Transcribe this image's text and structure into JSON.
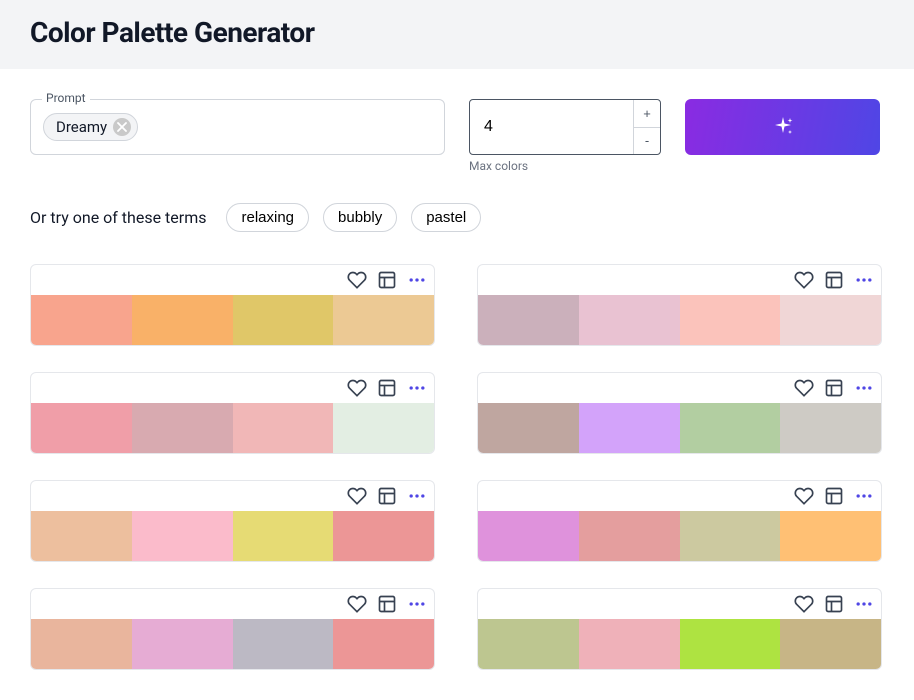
{
  "header": {
    "title": "Color Palette Generator"
  },
  "prompt": {
    "label": "Prompt",
    "tags": [
      "Dreamy"
    ]
  },
  "maxColors": {
    "value": "4",
    "label": "Max colors"
  },
  "suggest": {
    "intro": "Or try one of these terms",
    "items": [
      "relaxing",
      "bubbly",
      "pastel"
    ]
  },
  "palettes": [
    {
      "colors": [
        "#f8a48d",
        "#f9b168",
        "#e0c768",
        "#ecc994"
      ]
    },
    {
      "colors": [
        "#cbb0bb",
        "#e9c2d2",
        "#fbc3bb",
        "#f0d6d6"
      ]
    },
    {
      "colors": [
        "#f09ea8",
        "#d8aab0",
        "#f1b7b7",
        "#e3eee3"
      ]
    },
    {
      "colors": [
        "#bfa6a0",
        "#d3a3fa",
        "#b2cea1",
        "#cecbc5"
      ]
    },
    {
      "colors": [
        "#edbf9e",
        "#fbbbcb",
        "#e6db74",
        "#ec9696"
      ]
    },
    {
      "colors": [
        "#df92dc",
        "#e49e9e",
        "#ccc9a0",
        "#ffc074"
      ]
    },
    {
      "colors": [
        "#e9b59d",
        "#e6acd4",
        "#bcb9c4",
        "#ec9696"
      ]
    },
    {
      "colors": [
        "#bdc690",
        "#efb1b9",
        "#aee341",
        "#c7b586"
      ]
    }
  ]
}
